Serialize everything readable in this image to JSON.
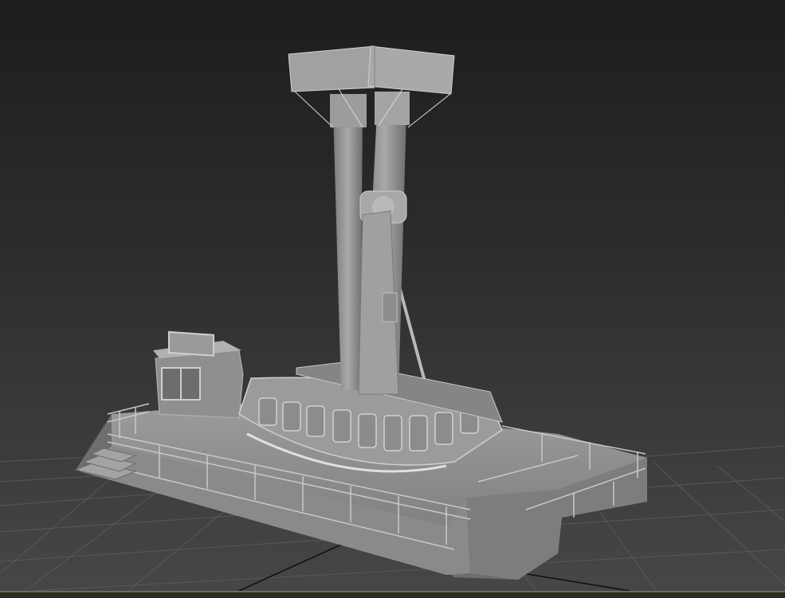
{
  "viewport": {
    "view": "perspective",
    "object": "pendulum-ride-model",
    "active_border_color": "#b09a4e",
    "grid_color": "#5b5b5b",
    "background_top": "#1d1d1d",
    "background_bottom": "#474747"
  }
}
